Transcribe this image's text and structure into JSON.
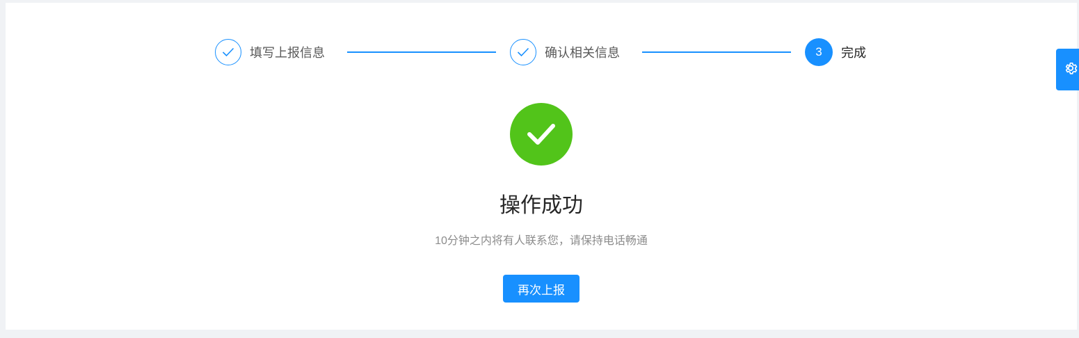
{
  "steps": [
    {
      "label": "填写上报信息",
      "status": "finished",
      "icon": "check-icon"
    },
    {
      "label": "确认相关信息",
      "status": "finished",
      "icon": "check-icon"
    },
    {
      "label": "完成",
      "status": "active",
      "number": "3"
    }
  ],
  "result": {
    "status": "success",
    "icon": "success-check-icon",
    "title": "操作成功",
    "subtitle": "10分钟之内将有人联系您，请保持电话畅通"
  },
  "actions": {
    "again_label": "再次上报"
  },
  "settings": {
    "icon": "gear-icon"
  },
  "colors": {
    "primary": "#1890ff",
    "success": "#52c41a",
    "background": "#f0f2f5"
  }
}
